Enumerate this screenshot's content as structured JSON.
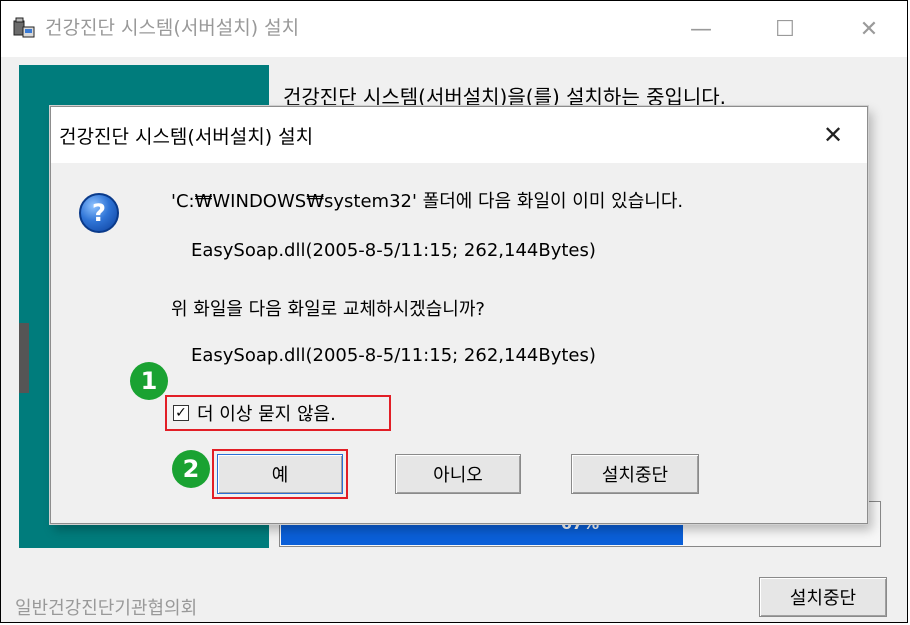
{
  "window": {
    "title": "건강진단 시스템(서버설치) 설치",
    "minimize_glyph": "—",
    "maximize_glyph": "☐",
    "close_glyph": "✕"
  },
  "installer": {
    "progress_message": "건강진단 시스템(서버설치)을(를) 설치하는 중입니다.",
    "progress_percent": 67,
    "progress_label": "67%",
    "organization": "일반건강진단기관협의회",
    "cancel_button": "설치중단"
  },
  "dialog": {
    "title": "건강진단 시스템(서버설치) 설치",
    "close_glyph": "✕",
    "icon": "question-icon",
    "message_line1": "'C:₩WINDOWS₩system32' 폴더에 다음 화일이 이미 있습니다.",
    "existing_file": "EasySoap.dll(2005-8-5/11:15; 262,144Bytes)",
    "question": "위 화일을 다음 화일로 교체하시겠습니까?",
    "new_file": "EasySoap.dll(2005-8-5/11:15; 262,144Bytes)",
    "checkbox_label": "더 이상 묻지 않음.",
    "checkbox_checked": true,
    "checkbox_mark": "✓",
    "yes_button": "예",
    "no_button": "아니오",
    "abort_button": "설치중단"
  },
  "annotations": {
    "badge1": "1",
    "badge2": "2",
    "accent_red": "#e21e26",
    "badge_green": "#1aa232"
  }
}
